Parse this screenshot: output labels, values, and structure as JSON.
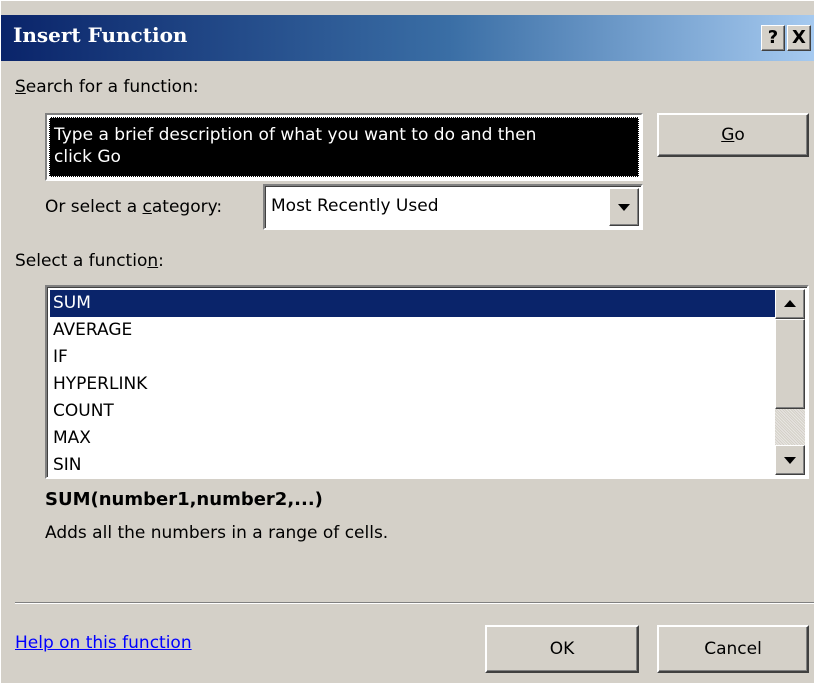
{
  "window": {
    "title": "Insert Function",
    "help_button": "?",
    "close_button": "X"
  },
  "search": {
    "label_prefix": "",
    "label_accel": "S",
    "label_rest": "earch for a function:",
    "value_line1": "Type a brief description of what you want to do and then",
    "value_line2": "click Go",
    "go_accel": "G",
    "go_rest": "o"
  },
  "category": {
    "label_prefix": "Or select a ",
    "label_accel": "c",
    "label_rest": "ategory:",
    "selected": "Most Recently Used"
  },
  "functions": {
    "label_prefix": "Select a functio",
    "label_accel": "n",
    "label_rest": ":",
    "items": [
      "SUM",
      "AVERAGE",
      "IF",
      "HYPERLINK",
      "COUNT",
      "MAX",
      "SIN"
    ],
    "selected_index": 0
  },
  "details": {
    "signature": "SUM(number1,number2,...)",
    "description": "Adds all the numbers in a range of cells."
  },
  "footer": {
    "help_link": "Help on this function",
    "ok_label": "OK",
    "cancel_label": "Cancel"
  },
  "colors": {
    "dialog_bg": "#d4d0c8",
    "titlebar_start": "#0a246a",
    "titlebar_end": "#a6caf0",
    "selection": "#0a246a",
    "link": "#0000ff"
  }
}
